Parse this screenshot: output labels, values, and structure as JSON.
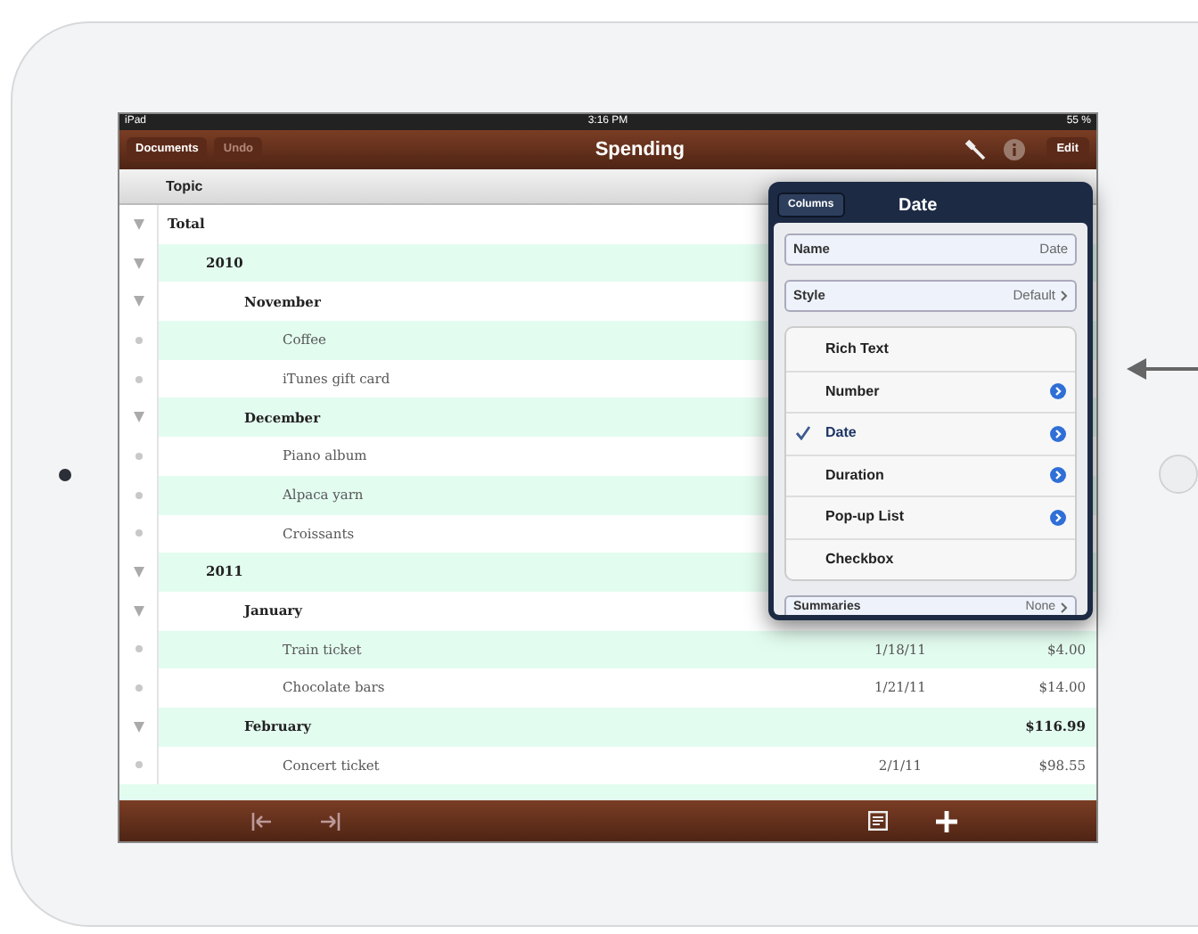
{
  "status_bar": {
    "device": "iPad",
    "time": "3:16 PM",
    "battery": "55 %"
  },
  "nav_bar": {
    "left_buttons": [
      {
        "label": "Documents",
        "disabled": false
      },
      {
        "label": "Undo",
        "disabled": true
      }
    ],
    "title": "Spending",
    "edit_button": "Edit"
  },
  "table": {
    "columns": [
      "Topic"
    ],
    "rows": [
      {
        "topic": "Total",
        "children": [
          {
            "topic": "2010",
            "children": [
              {
                "topic": "November",
                "children": [
                  {
                    "topic": "Coffee"
                  },
                  {
                    "topic": "iTunes gift card"
                  }
                ]
              },
              {
                "topic": "December",
                "children": [
                  {
                    "topic": "Piano album"
                  },
                  {
                    "topic": "Alpaca yarn"
                  },
                  {
                    "topic": "Croissants"
                  }
                ]
              }
            ]
          },
          {
            "topic": "2011",
            "children": [
              {
                "topic": "January",
                "children": [
                  {
                    "topic": "Train ticket",
                    "date": "1/18/11",
                    "amount": "$4.00"
                  },
                  {
                    "topic": "Chocolate bars",
                    "date": "1/21/11",
                    "amount": "$14.00"
                  }
                ]
              },
              {
                "topic": "February",
                "amount": "$116.99",
                "children": [
                  {
                    "topic": "Concert ticket",
                    "date": "2/1/11",
                    "amount": "$98.55"
                  }
                ]
              }
            ]
          }
        ]
      }
    ]
  },
  "popover": {
    "back_button": "Columns",
    "title": "Date",
    "name_field": {
      "label": "Name",
      "value": "Date"
    },
    "style_row": {
      "label": "Style",
      "value": "Default"
    },
    "types": [
      {
        "label": "Rich Text",
        "selected": false,
        "detail": false
      },
      {
        "label": "Number",
        "selected": false,
        "detail": true
      },
      {
        "label": "Date",
        "selected": true,
        "detail": true
      },
      {
        "label": "Duration",
        "selected": false,
        "detail": true
      },
      {
        "label": "Pop-up List",
        "selected": false,
        "detail": true
      },
      {
        "label": "Checkbox",
        "selected": false,
        "detail": false
      }
    ],
    "summaries_row": {
      "label": "Summaries",
      "value": "None"
    }
  }
}
